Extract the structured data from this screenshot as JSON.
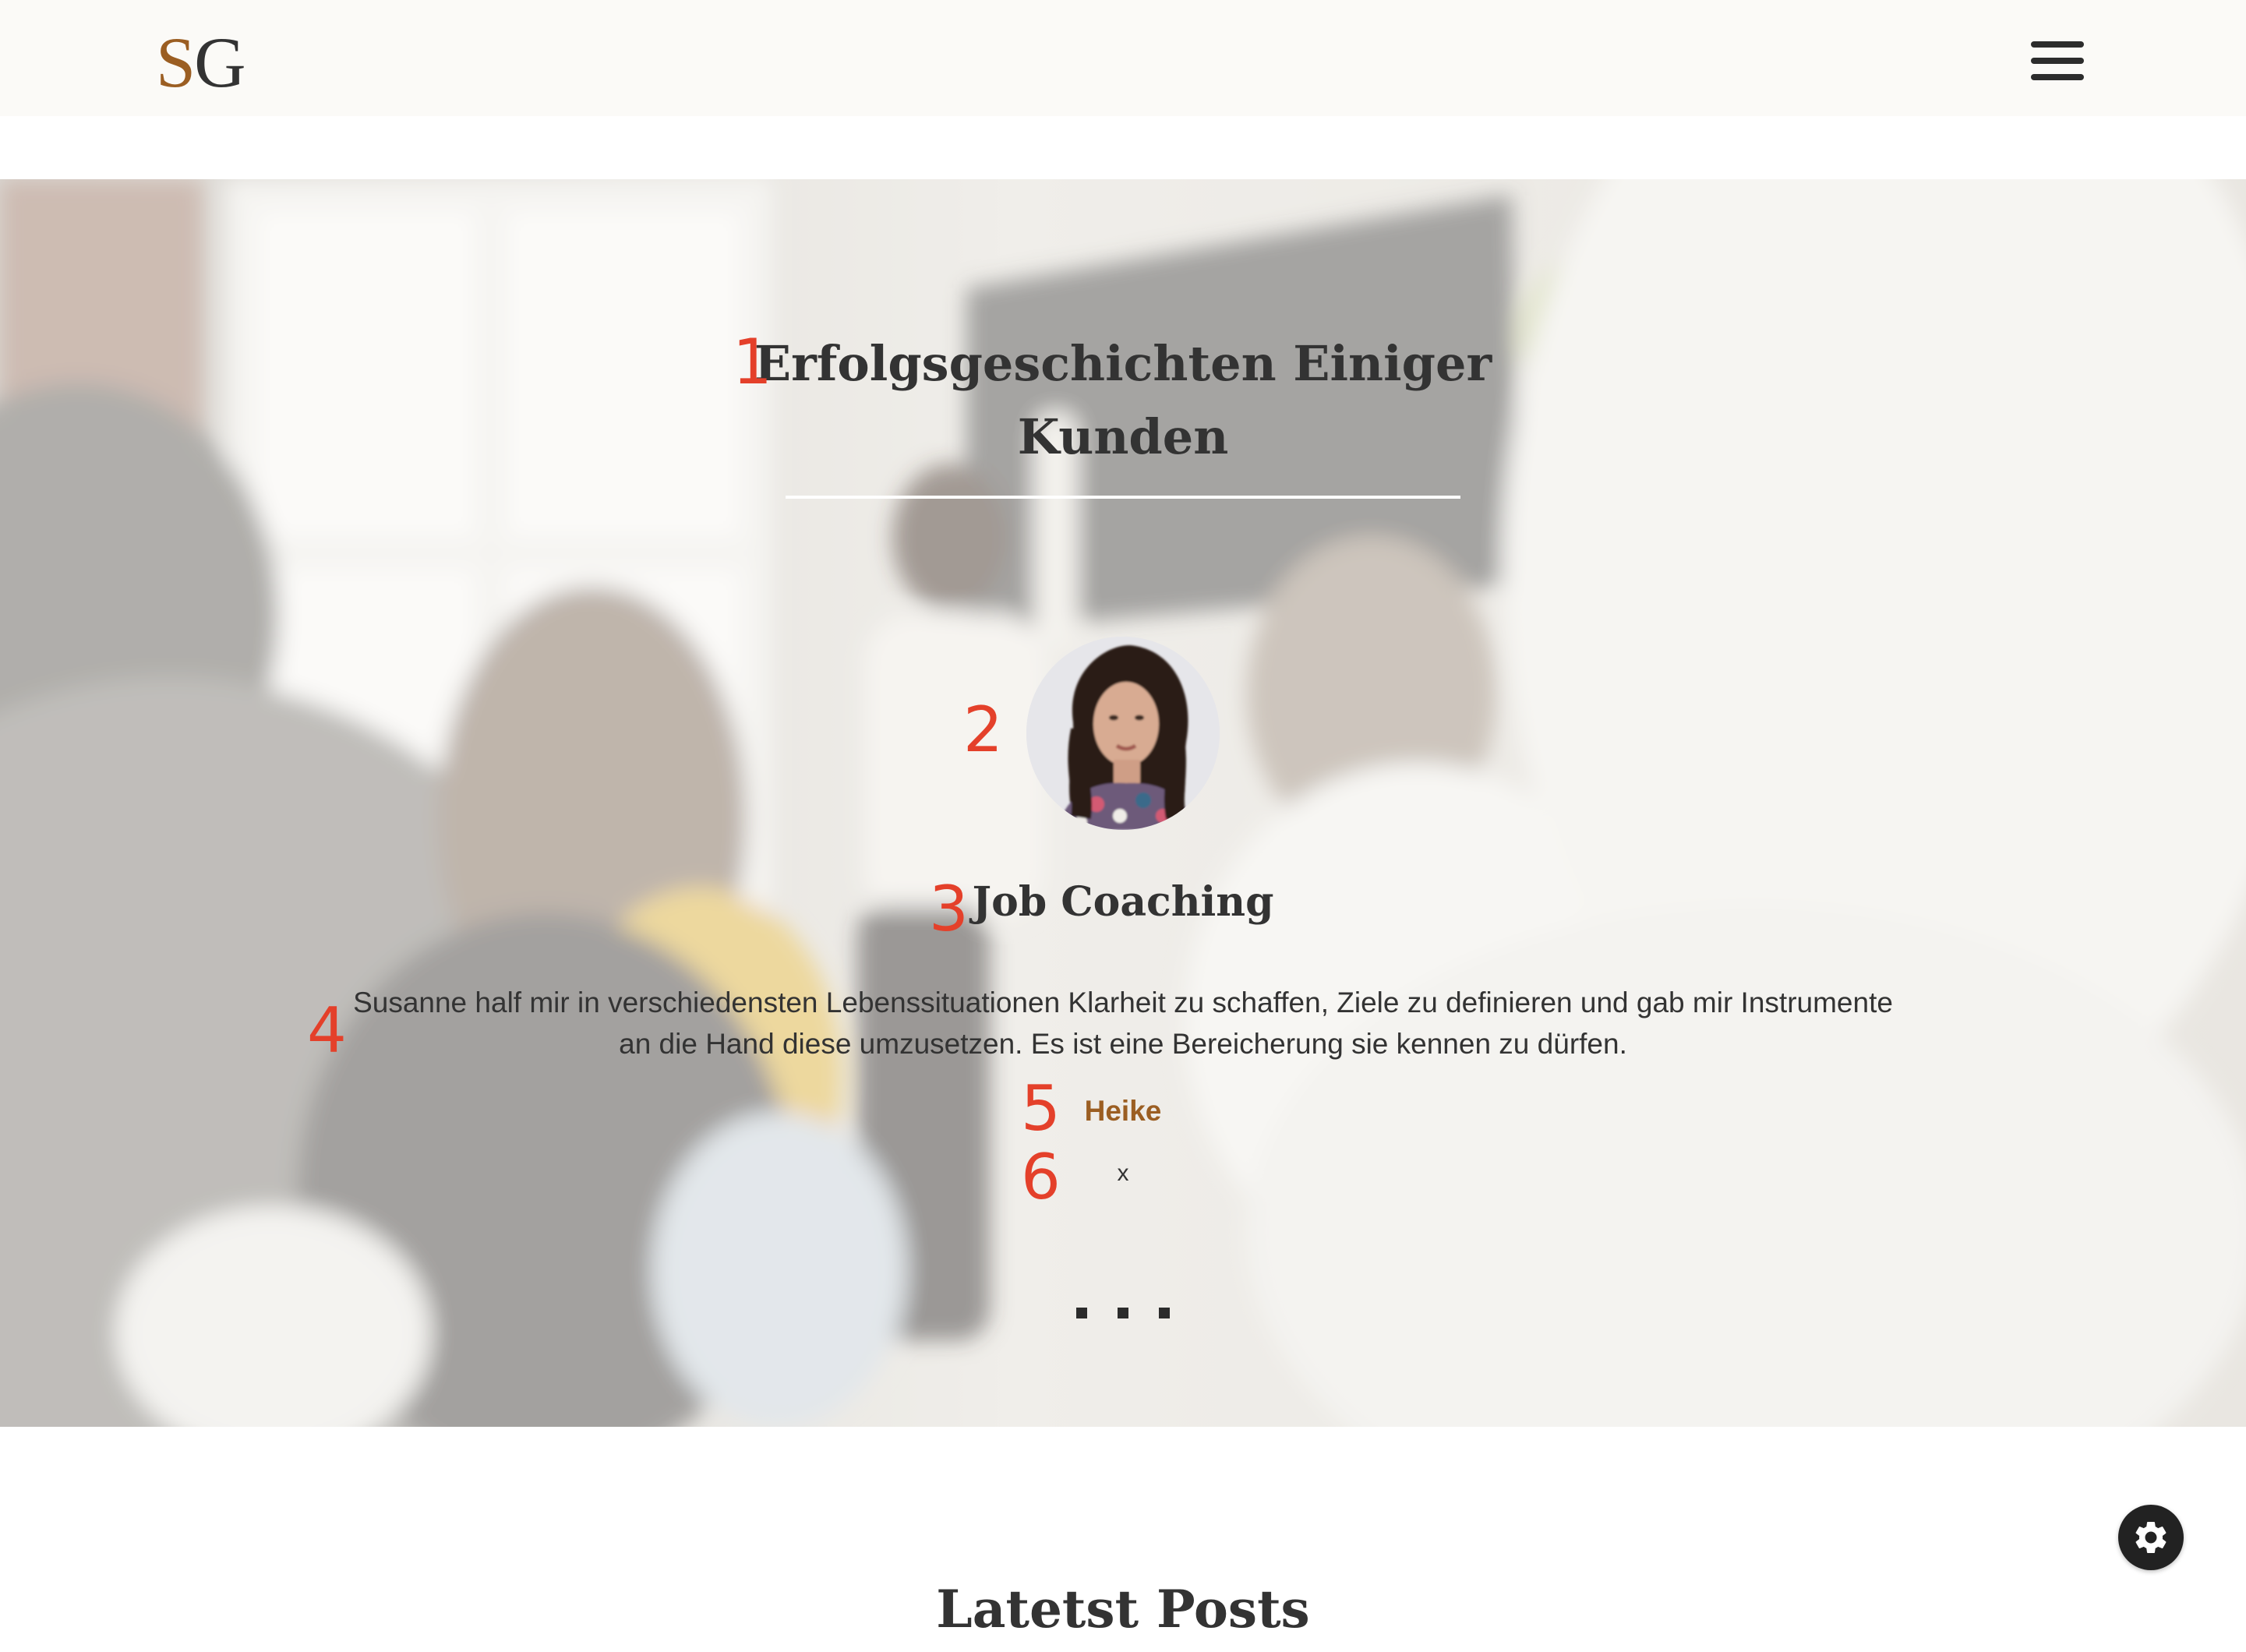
{
  "header": {
    "logo_s": "S",
    "logo_g": "G",
    "menu_icon": "hamburger-menu-icon"
  },
  "testimonials": {
    "title": "Erfolgsgeschichten Einiger Kunden",
    "service": "Job Coaching",
    "quote": "Susanne half mir in verschiedensten Lebenssituationen Klarheit zu schaffen, Ziele zu definieren und gab mir Instrumente an die Hand diese umzusetzen. Es ist eine Bereicherung sie kennen zu dürfen.",
    "author": "Heike",
    "close": "x",
    "slides": 3
  },
  "markers": [
    "1",
    "2",
    "3",
    "4",
    "5",
    "6"
  ],
  "posts": {
    "title": "Latetst Posts"
  },
  "settings": {
    "icon": "gear-icon"
  },
  "colors": {
    "accent": "#9b5e22",
    "marker": "#e4402a",
    "text": "#333333",
    "header_bg": "#fbfaf7"
  }
}
